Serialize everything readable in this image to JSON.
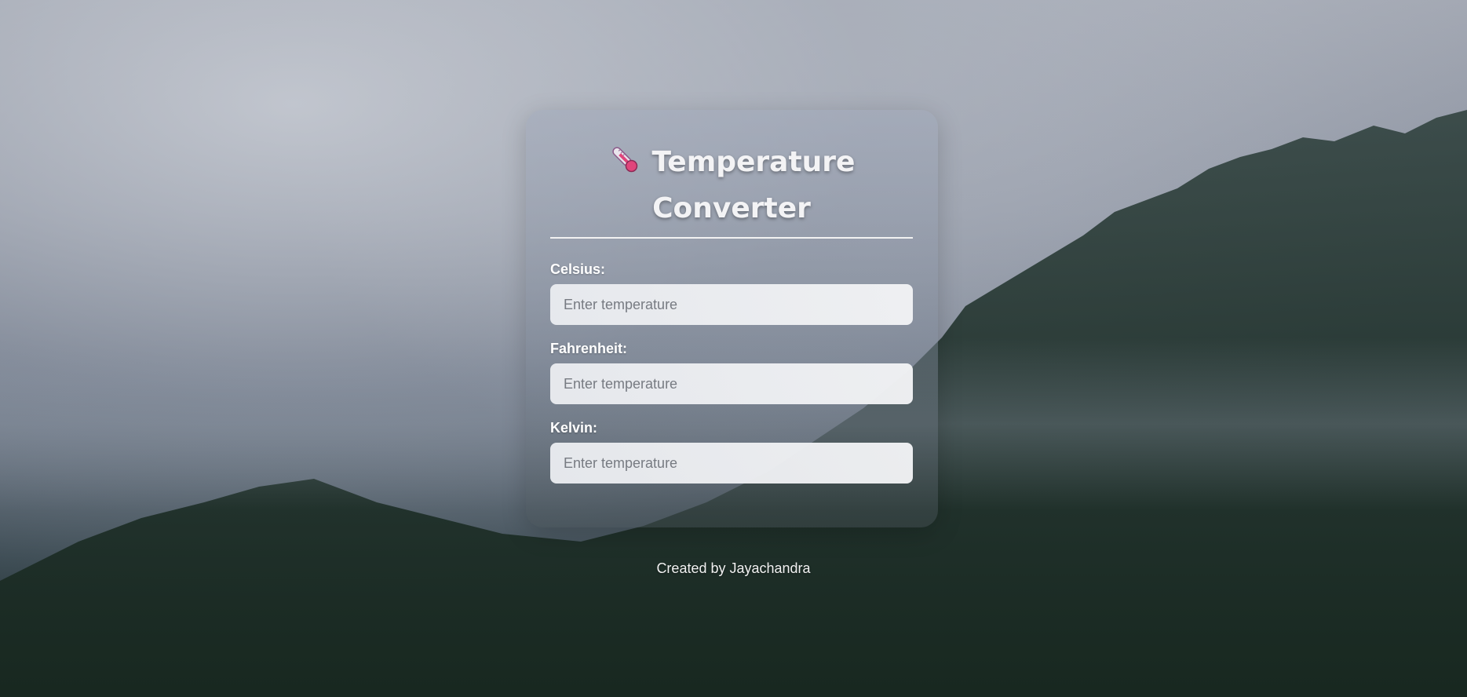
{
  "app": {
    "title": "Temperature Converter",
    "icon": "thermometer-icon",
    "accent_color": "#e0457b"
  },
  "form": {
    "fields": [
      {
        "label": "Celsius:",
        "placeholder": "Enter temperature",
        "value": ""
      },
      {
        "label": "Fahrenheit:",
        "placeholder": "Enter temperature",
        "value": ""
      },
      {
        "label": "Kelvin:",
        "placeholder": "Enter temperature",
        "value": ""
      }
    ]
  },
  "footer": {
    "text": "Created by Jayachandra"
  }
}
